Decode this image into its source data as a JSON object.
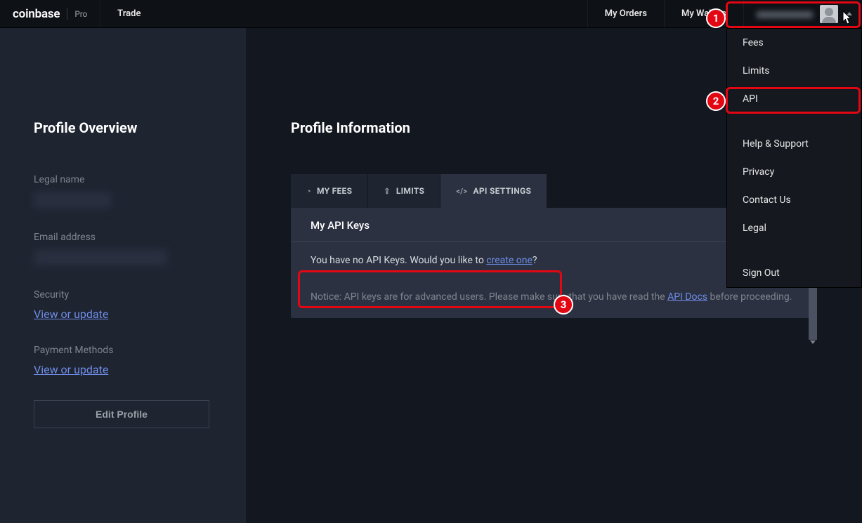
{
  "brand": {
    "name": "coinbase",
    "suffix": "Pro"
  },
  "nav": {
    "trade": "Trade",
    "my_orders": "My Orders",
    "my_wallets": "My Wallets"
  },
  "dropdown": {
    "fees": "Fees",
    "limits": "Limits",
    "api": "API",
    "help": "Help & Support",
    "privacy": "Privacy",
    "contact": "Contact Us",
    "legal": "Legal",
    "signout": "Sign Out"
  },
  "sidebar": {
    "title": "Profile Overview",
    "legal_name_label": "Legal name",
    "email_label": "Email address",
    "security_label": "Security",
    "security_link": "View or update",
    "payment_label": "Payment Methods",
    "payment_link": "View or update",
    "edit_button": "Edit Profile"
  },
  "main": {
    "title": "Profile Information",
    "tabs": {
      "fees": "MY FEES",
      "limits": "LIMITS",
      "api": "API SETTINGS"
    },
    "panel": {
      "title": "My API Keys",
      "no_keys_prefix": "You have no API Keys. Would you like to ",
      "create_link": "create one",
      "no_keys_suffix": "?",
      "notice_prefix": "Notice: API keys are for advanced users. Please make sure that you have read the ",
      "docs_link": "API Docs",
      "notice_suffix": " before proceeding."
    }
  },
  "callouts": {
    "n1": "1",
    "n2": "2",
    "n3": "3"
  }
}
